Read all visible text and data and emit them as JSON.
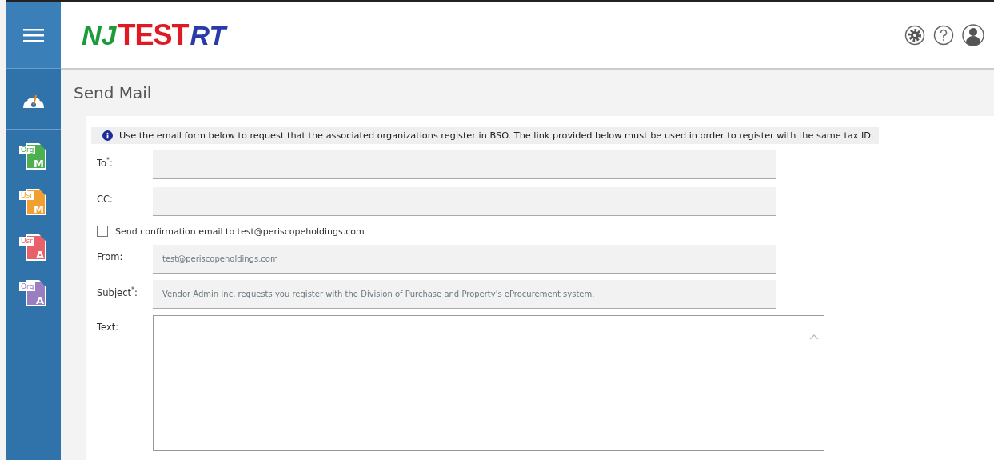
{
  "logo": {
    "first": "NJ",
    "overlay": "TEST",
    "second": "RT"
  },
  "page_title": "Send Mail",
  "sidebar": {
    "items": [
      {
        "kind": "dashboard"
      },
      {
        "kind": "file",
        "tag": "Org",
        "letter": "M",
        "color": "#4caf50"
      },
      {
        "kind": "file",
        "tag": "Usr",
        "letter": "M",
        "color": "#f0a030"
      },
      {
        "kind": "file",
        "tag": "Usr",
        "letter": "A",
        "color": "#e8606a"
      },
      {
        "kind": "file",
        "tag": "Org",
        "letter": "A",
        "color": "#9a7fc0"
      }
    ]
  },
  "info": "Use the email form below to request that the associated organizations register in BSO. The link provided below must be used in order to register with the same tax ID.",
  "form": {
    "to": {
      "label": "To$^{*}$:"
    },
    "cc": {
      "label": "CC:"
    },
    "confirm": {
      "label": "Send confirmation email to test@periscopeholdings.com",
      "checked": false
    },
    "from": {
      "label": "From:",
      "value": "test@periscopeholdings.com"
    },
    "subject": {
      "label": "Subject$^{*}$:",
      "value": "Vendor Admin Inc. requests you register with the Division of Purchase and Property's eProcurement system."
    },
    "text": {
      "label": "Text:"
    }
  }
}
